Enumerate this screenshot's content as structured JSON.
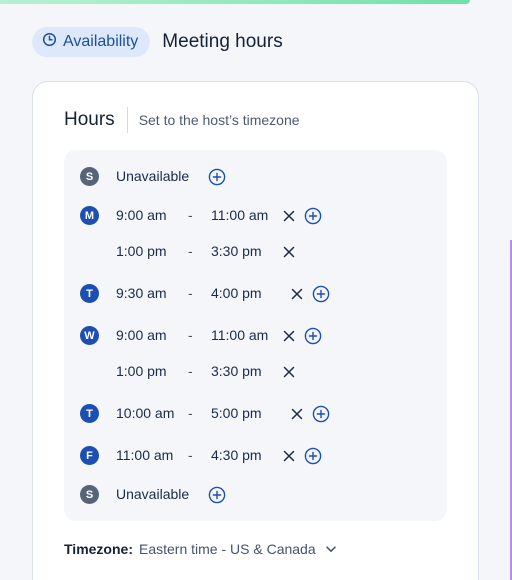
{
  "header": {
    "pill_label": "Availability",
    "title": "Meeting hours"
  },
  "card": {
    "title": "Hours",
    "subtitle": "Set to the host’s timezone"
  },
  "schedule": {
    "sun": {
      "letter": "S",
      "text": "Unavailable"
    },
    "mon": {
      "letter": "M",
      "slots": [
        {
          "start": "9:00 am",
          "end": "11:00 am"
        },
        {
          "start": "1:00 pm",
          "end": "3:30 pm"
        }
      ]
    },
    "tue": {
      "letter": "T",
      "slots": [
        {
          "start": "9:30 am",
          "end": "4:00 pm"
        }
      ]
    },
    "wed": {
      "letter": "W",
      "slots": [
        {
          "start": "9:00 am",
          "end": "11:00 am"
        },
        {
          "start": "1:00 pm",
          "end": "3:30 pm"
        }
      ]
    },
    "thu": {
      "letter": "T",
      "slots": [
        {
          "start": "10:00 am",
          "end": "5:00 pm"
        }
      ]
    },
    "fri": {
      "letter": "F",
      "slots": [
        {
          "start": "11:00 am",
          "end": "4:30 pm"
        }
      ]
    },
    "sat": {
      "letter": "S",
      "text": "Unavailable"
    },
    "dash": "-"
  },
  "timezone": {
    "label": "Timezone:",
    "value": "Eastern time - US & Canada"
  },
  "colors": {
    "accent": "#1c4fb0",
    "pill_bg": "#dde9fb",
    "unavailable_badge": "#576478"
  },
  "icons": {
    "pill": "clock-icon",
    "remove": "close-icon",
    "add": "plus-circle-icon",
    "dropdown": "chevron-down-icon"
  }
}
